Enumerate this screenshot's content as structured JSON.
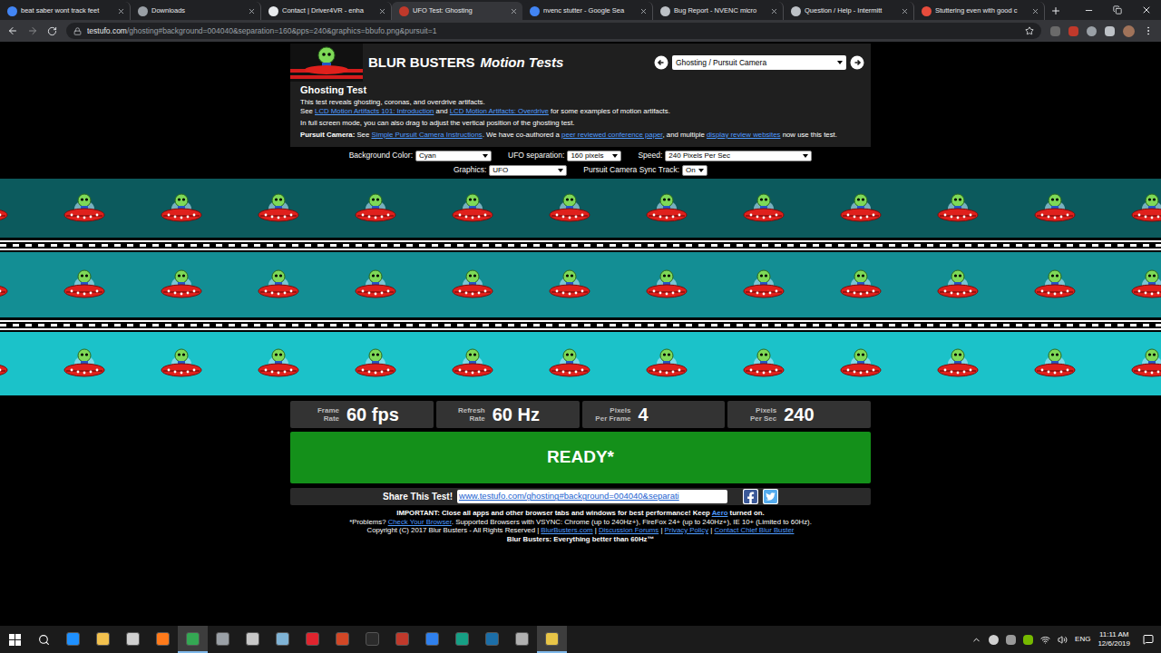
{
  "browser": {
    "tabs": [
      {
        "title": "beat saber wont track feet",
        "selected": false,
        "color": "#4285f4"
      },
      {
        "title": "Downloads",
        "selected": false,
        "color": "#9aa0a6"
      },
      {
        "title": "Contact | Driver4VR - enha",
        "selected": false,
        "color": "#e8eaed"
      },
      {
        "title": "UFO Test: Ghosting",
        "selected": true,
        "color": "#c0392b"
      },
      {
        "title": "nvenc stutter - Google Sea",
        "selected": false,
        "color": "#4285f4"
      },
      {
        "title": "Bug Report - NVENC micro",
        "selected": false,
        "color": "#bdc1c6"
      },
      {
        "title": "Question / Help - Intermitt",
        "selected": false,
        "color": "#bdc1c6"
      },
      {
        "title": "Stuttering even with good c",
        "selected": false,
        "color": "#e74c3c"
      }
    ],
    "address": {
      "host": "testufo.com",
      "path": "/ghosting#background=004040&separation=160&pps=240&graphics=bbufo.png&pursuit=1"
    }
  },
  "page": {
    "header": {
      "brand": "BLUR BUSTERS",
      "subtitle": "Motion Tests",
      "test_select": "Ghosting / Pursuit Camera"
    },
    "test": {
      "title": "Ghosting Test",
      "paragraphs": [
        [
          [
            {
              "text": "This test reveals ghosting, coronas, and overdrive artifacts.",
              "link": false,
              "bold": false
            }
          ],
          [
            {
              "text": "See ",
              "link": false,
              "bold": false
            },
            {
              "text": "LCD Motion Artifacts 101: Introduction",
              "link": true,
              "bold": false
            },
            {
              "text": " and ",
              "link": false,
              "bold": false
            },
            {
              "text": "LCD Motion Artifacts: Overdrive",
              "link": true,
              "bold": false
            },
            {
              "text": " for some examples of motion artifacts.",
              "link": false,
              "bold": false
            }
          ]
        ],
        [
          [
            {
              "text": "In full screen mode, you can also drag to adjust the vertical position of the ghosting test.",
              "link": false,
              "bold": false
            }
          ]
        ],
        [
          [
            {
              "text": "Pursuit Camera:",
              "link": false,
              "bold": true
            },
            {
              "text": " See ",
              "link": false,
              "bold": false
            },
            {
              "text": "Simple Pursuit Camera Instructions",
              "link": true,
              "bold": false
            },
            {
              "text": ". We have co-authored a ",
              "link": false,
              "bold": false
            },
            {
              "text": "peer reviewed conference paper",
              "link": true,
              "bold": false
            },
            {
              "text": ", and multiple ",
              "link": false,
              "bold": false
            },
            {
              "text": "display review websites",
              "link": true,
              "bold": false
            },
            {
              "text": " now use this test.",
              "link": false,
              "bold": false
            }
          ]
        ]
      ]
    },
    "controls": [
      [
        {
          "label": "Background Color:",
          "value": "Cyan"
        },
        {
          "label": "UFO separation:",
          "value": "160 pixels"
        },
        {
          "label": "Speed:",
          "value": "240 Pixels Per Sec"
        }
      ],
      [
        {
          "label": "Graphics:",
          "value": "UFO"
        },
        {
          "label": "Pursuit Camera Sync Track:",
          "value": "On"
        }
      ]
    ],
    "tracks": [
      {
        "color": "#0c5a5d"
      },
      {
        "color": "#138e94"
      },
      {
        "color": "#1bc2c9"
      }
    ],
    "stats": [
      {
        "label": [
          "Frame",
          "Rate"
        ],
        "value": "60 fps"
      },
      {
        "label": [
          "Refresh",
          "Rate"
        ],
        "value": "60 Hz"
      },
      {
        "label": [
          "Pixels",
          "Per Frame"
        ],
        "value": "4"
      },
      {
        "label": [
          "Pixels",
          "Per Sec"
        ],
        "value": "240"
      }
    ],
    "start_button": "READY*",
    "share": {
      "label": "Share This Test!",
      "url": "www.testufo.com/ghosting#background=004040&separati"
    },
    "footer": [
      [
        {
          "text": "IMPORTANT: Close all apps and other browser tabs and windows for best performance! Keep ",
          "link": false,
          "bold": true
        },
        {
          "text": "Aero",
          "link": true,
          "bold": true
        },
        {
          "text": " turned on.",
          "link": false,
          "bold": true
        }
      ],
      [
        {
          "text": "*Problems? ",
          "link": false,
          "bold": false
        },
        {
          "text": "Check Your Browser",
          "link": true,
          "bold": false
        },
        {
          "text": ". Supported Browsers with VSYNC: Chrome (up to 240Hz+), FireFox 24+ (up to 240Hz+), IE 10+ (Limited to 60Hz).",
          "link": false,
          "bold": false
        }
      ],
      [
        {
          "text": "Copyright (C) 2017 Blur Busters - All Rights Reserved | ",
          "link": false,
          "bold": false
        },
        {
          "text": "BlurBusters.com",
          "link": true,
          "bold": false
        },
        {
          "text": " | ",
          "link": false,
          "bold": false
        },
        {
          "text": "Discussion Forums",
          "link": true,
          "bold": false
        },
        {
          "text": " | ",
          "link": false,
          "bold": false
        },
        {
          "text": "Privacy Policy",
          "link": true,
          "bold": false
        },
        {
          "text": " | ",
          "link": false,
          "bold": false
        },
        {
          "text": "Contact Chief Blur Buster",
          "link": true,
          "bold": false
        }
      ],
      [
        {
          "text": "Blur Busters: Everything better than 60Hz™",
          "link": false,
          "bold": true
        }
      ]
    ]
  },
  "taskbar": {
    "apps": [
      {
        "color": "#1e90ff",
        "selected": false
      },
      {
        "color": "#f2c14e",
        "selected": false
      },
      {
        "color": "#d0d0d0",
        "selected": false
      },
      {
        "color": "#ff7a1a",
        "selected": false
      },
      {
        "color": "#34a853",
        "selected": true
      },
      {
        "color": "#9aa0a6",
        "selected": false
      },
      {
        "color": "#c8c8c8",
        "selected": false
      },
      {
        "color": "#7fb3d5",
        "selected": false
      },
      {
        "color": "#e0242e",
        "selected": false
      },
      {
        "color": "#d24726",
        "selected": false
      },
      {
        "color": "#2b2b2b",
        "selected": false
      },
      {
        "color": "#c0392b",
        "selected": false
      },
      {
        "color": "#2f80ed",
        "selected": false
      },
      {
        "color": "#16a085",
        "selected": false
      },
      {
        "color": "#1b6ea8",
        "selected": false
      },
      {
        "color": "#b0b0b0",
        "selected": false
      },
      {
        "color": "#e8c547",
        "selected": true
      }
    ],
    "tray": {
      "language": "ENG",
      "time": "11:11 AM",
      "date": "12/6/2019"
    }
  }
}
